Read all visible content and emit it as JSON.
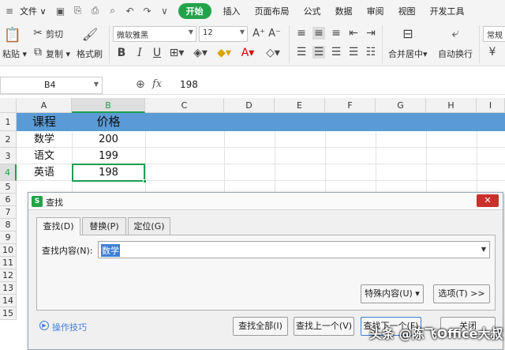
{
  "menubar": {
    "file_label": "文件",
    "tabs": [
      "开始",
      "插入",
      "页面布局",
      "公式",
      "数据",
      "审阅",
      "视图",
      "开发工具"
    ]
  },
  "toolbar": {
    "paste": "粘贴",
    "cut": "剪切",
    "copy": "复制",
    "format_painter": "格式刷",
    "font_name": "微软雅黑",
    "font_size": "12",
    "bold": "B",
    "italic": "I",
    "underline": "U",
    "merge_center": "合并居中",
    "wrap_text": "自动换行",
    "number_format": "常规"
  },
  "formula_bar": {
    "cell_ref": "B4",
    "fx": "fx",
    "value": "198"
  },
  "sheet": {
    "columns": [
      "A",
      "B",
      "C",
      "D",
      "E",
      "F",
      "G",
      "H",
      "I"
    ],
    "rows": [
      "1",
      "2",
      "3",
      "4",
      "5",
      "6",
      "7",
      "8",
      "9",
      "10",
      "11",
      "12",
      "13",
      "14",
      "15"
    ],
    "header": {
      "a": "课程",
      "b": "价格"
    },
    "data": [
      {
        "a": "数学",
        "b": "200"
      },
      {
        "a": "语文",
        "b": "199"
      },
      {
        "a": "英语",
        "b": "198"
      }
    ],
    "header_fill": "#5b9bd5",
    "selection_color": "#1f9e52"
  },
  "dialog": {
    "title": "查找",
    "tabs": {
      "find": "查找(D)",
      "replace": "替换(P)",
      "goto": "定位(G)"
    },
    "find_label": "查找内容(N):",
    "find_value": "数学",
    "special_button": "特殊内容(U)",
    "options_button": "选项(T) >>",
    "tips_link": "操作技巧",
    "find_all": "查找全部(I)",
    "find_prev": "查找上一个(V)",
    "find_next": "查找下一个(F)",
    "close": "关闭"
  },
  "watermark": "头条 @陈飞Office大叔"
}
